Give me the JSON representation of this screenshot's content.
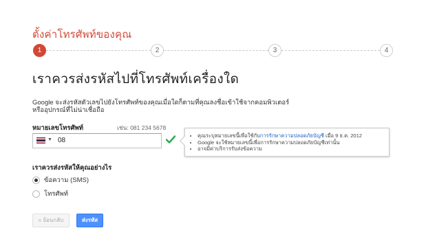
{
  "page": {
    "title": "ตั้งค่าโทรศัพท์ของคุณ",
    "heading": "เราควรส่งรหัสไปที่โทรศัพท์เครื่องใด",
    "description": "Google จะส่งรหัสตัวเลขไปยังโทรศัพท์ของคุณเมื่อใดก็ตามที่คุณลงชื่อเข้าใช้จากคอมพิวเตอร์ หรืออุปกรณ์ที่ไม่น่าเชื่อถือ"
  },
  "steps": [
    {
      "label": "1",
      "active": true
    },
    {
      "label": "2",
      "active": false
    },
    {
      "label": "3",
      "active": false
    },
    {
      "label": "4",
      "active": false
    }
  ],
  "phone": {
    "label": "หมายเลขโทรศัพท์",
    "example": "เช่น: 081 234 5678",
    "value": "08",
    "country_icon": "thailand-flag-icon",
    "valid_icon": "checkmark-icon",
    "accent_color": "#33a852"
  },
  "tooltip": {
    "items": [
      {
        "prefix": "คุณระบุหมายเลขนี้เพื่อใช้กับ",
        "link": "การรักษาความปลอดภัยบัญชี",
        "suffix": " เมื่อ 9 ธ.ค. 2012"
      },
      {
        "prefix": "Google จะใช้หมายเลขนี้เพื่อการรักษาความปลอดภัยบัญชีเท่านั้น",
        "link": "",
        "suffix": ""
      },
      {
        "prefix": "อาจมีค่าบริการรับส่งข้อความ",
        "link": "",
        "suffix": ""
      }
    ]
  },
  "method": {
    "label": "เราควรส่งรหัสให้คุณอย่างไร",
    "options": [
      {
        "label": "ข้อความ (SMS)",
        "checked": true
      },
      {
        "label": "โทรศัพท์",
        "checked": false
      }
    ]
  },
  "buttons": {
    "back": "« ย้อนกลับ",
    "next": "ส่งรหัส"
  },
  "colors": {
    "title": "#d14836",
    "primary_button": "#4d90fe",
    "link": "#1a5fc1"
  }
}
